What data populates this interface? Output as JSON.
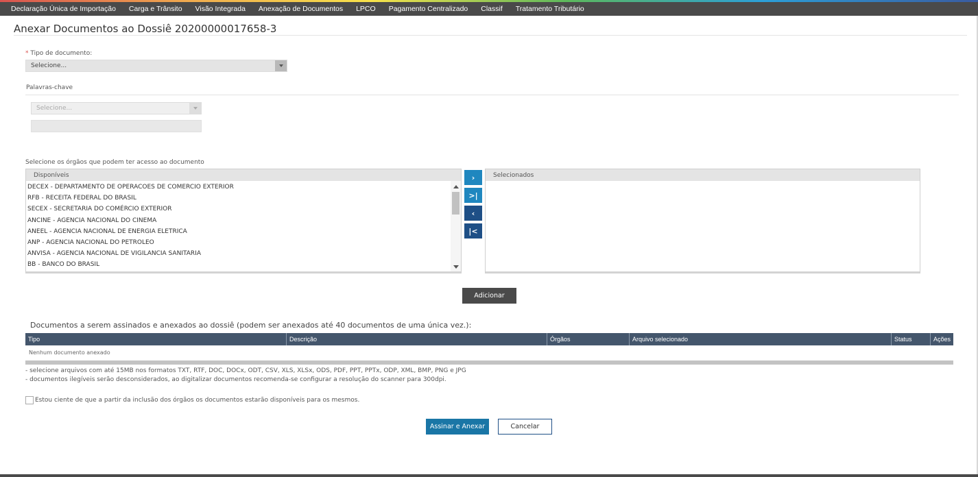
{
  "nav": {
    "items": [
      "Declaração Única de Importação",
      "Carga e Trânsito",
      "Visão Integrada",
      "Anexação de Documentos",
      "LPCO",
      "Pagamento Centralizado",
      "Classif",
      "Tratamento Tributário"
    ]
  },
  "page": {
    "title": "Anexar Documentos ao Dossiê 20200000017658-3"
  },
  "form": {
    "tipo": {
      "required_mark": "*",
      "label": "Tipo de documento:",
      "value": "Selecione..."
    },
    "keywords": {
      "label": "Palavras-chave",
      "select_value": "Selecione..."
    },
    "orgaos": {
      "label": "Selecione os órgãos que podem ter acesso ao documento",
      "available_header": "Disponíveis",
      "selected_header": "Selecionados",
      "available": [
        "DECEX - DEPARTAMENTO DE OPERACOES DE COMERCIO EXTERIOR",
        "RFB - RECEITA FEDERAL DO BRASIL",
        "SECEX - SECRETARIA DO COMÉRCIO EXTERIOR",
        "ANCINE - AGENCIA NACIONAL DO CINEMA",
        "ANEEL - AGENCIA NACIONAL DE ENERGIA ELETRICA",
        "ANP - AGENCIA NACIONAL DO PETROLEO",
        "ANVISA - AGENCIA NACIONAL DE VIGILANCIA SANITARIA",
        "BB - BANCO DO BRASIL"
      ],
      "buttons": {
        "move_one": "›",
        "move_all": ">|",
        "remove_one": "‹",
        "remove_all": "|<"
      }
    },
    "add_button": "Adicionar"
  },
  "documents": {
    "title": "Documentos a serem assinados e anexados ao dossiê (podem ser anexados até 40 documentos de uma única vez.):",
    "columns": [
      "Tipo",
      "Descrição",
      "Órgãos",
      "Arquivo selecionado",
      "Status",
      "Ações"
    ],
    "empty": "Nenhum documento anexado"
  },
  "notes": [
    "- selecione arquivos com até 15MB nos formatos TXT, RTF, DOC, DOCx, ODT, CSV, XLS, XLSx, ODS, PDF, PPT, PPTx, ODP, XML, BMP, PNG e JPG",
    "- documentos ilegíveis serão desconsiderados, ao digitalizar documentos recomenda-se configurar a resolução do scanner para 300dpi."
  ],
  "consent": {
    "label": "Estou ciente de que a partir da inclusão dos órgãos os documentos estarão disponíveis para os mesmos."
  },
  "actions": {
    "sign": "Assinar e Anexar",
    "cancel": "Cancelar"
  },
  "colors": {
    "nav_bg": "#4a4a4a",
    "grid_header": "#44566c",
    "primary": "#1a76a6",
    "move_light": "#1f87bf",
    "move_dark": "#1e4f86"
  }
}
